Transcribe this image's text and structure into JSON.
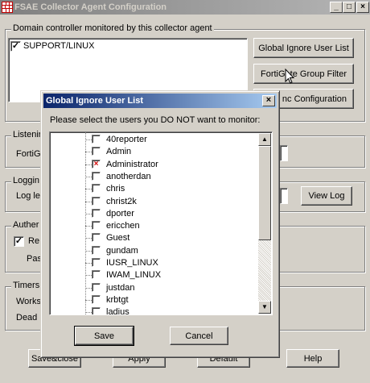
{
  "window": {
    "title": "FSAE Collector Agent Configuration",
    "minimize": "_",
    "maximize": "□",
    "close": "×"
  },
  "domain_group": {
    "title": "Domain controller monitored by this collector agent",
    "items": [
      {
        "label": "SUPPORT/LINUX",
        "checked": true
      }
    ]
  },
  "side_buttons": {
    "global_ignore": "Global Ignore User List",
    "group_filter": "FortiGate Group Filter",
    "sync_config": "nc Configuration"
  },
  "listening_group": {
    "title": "Listenir",
    "label": "FortiG"
  },
  "logging_group": {
    "title": "Loggin",
    "label": "Log le",
    "view_log": "View Log"
  },
  "auth_group": {
    "title": "Auther",
    "checkbox_label": "Re",
    "password_label": "Pas"
  },
  "timers_group": {
    "title": "Timers",
    "row1": "Works",
    "row2": "Dead"
  },
  "bottom_buttons": {
    "save_close": "Save&close",
    "apply": "Apply",
    "default": "Default",
    "help": "Help"
  },
  "dialog": {
    "title": "Global Ignore User List",
    "close": "×",
    "prompt": "Please select the users you DO NOT want to monitor:",
    "users": [
      {
        "name": "40reporter",
        "checked": false
      },
      {
        "name": "Admin",
        "checked": false
      },
      {
        "name": "Administrator",
        "checked": true
      },
      {
        "name": "anotherdan",
        "checked": false
      },
      {
        "name": "chris",
        "checked": false
      },
      {
        "name": "christ2k",
        "checked": false
      },
      {
        "name": "dporter",
        "checked": false
      },
      {
        "name": "ericchen",
        "checked": false
      },
      {
        "name": "Guest",
        "checked": false
      },
      {
        "name": "gundam",
        "checked": false
      },
      {
        "name": "IUSR_LINUX",
        "checked": false
      },
      {
        "name": "IWAM_LINUX",
        "checked": false
      },
      {
        "name": "justdan",
        "checked": false
      },
      {
        "name": "krbtgt",
        "checked": false
      },
      {
        "name": "ladius",
        "checked": false
      }
    ],
    "save": "Save",
    "cancel": "Cancel",
    "scroll_position": 0.0,
    "check_mark": "×",
    "check_color": "#d00000"
  },
  "theme": {
    "active_title": "#0a246a",
    "inactive_title": "#808080",
    "face": "#d4d0c8"
  }
}
